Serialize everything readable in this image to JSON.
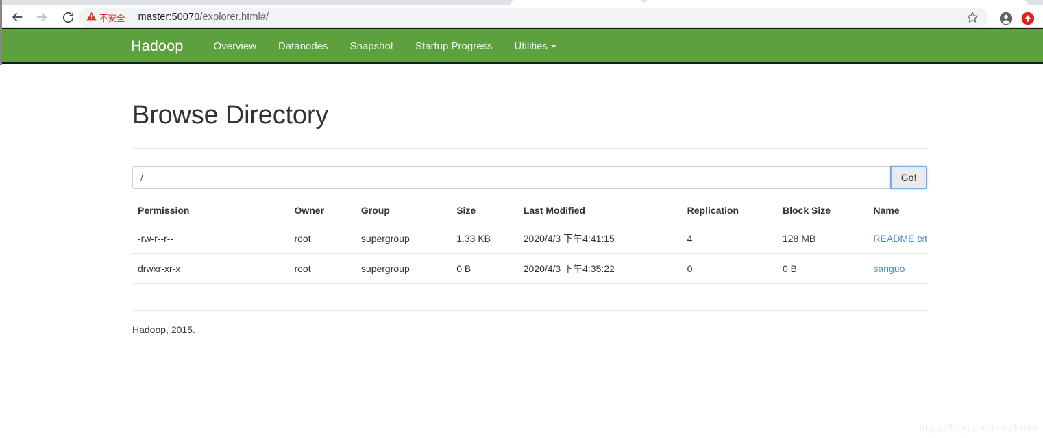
{
  "browser": {
    "back_icon": "arrow-left-icon",
    "forward_icon": "arrow-right-icon",
    "reload_icon": "reload-icon",
    "security_warning": "不安全",
    "security_icon": "warning-triangle-icon",
    "url_host": "master:50070",
    "url_path": "/explorer.html#/",
    "url_full": "master:50070/explorer.html#/",
    "star_icon": "star-icon",
    "avatar_icon": "account-circle-icon",
    "extension_icon": "extension-icon",
    "accent_red": "#d93025",
    "omnibox_bg": "#f1f3f4"
  },
  "navbar": {
    "brand": "Hadoop",
    "bg_color": "#5da13f",
    "links": [
      {
        "label": "Overview",
        "has_caret": false
      },
      {
        "label": "Datanodes",
        "has_caret": false
      },
      {
        "label": "Snapshot",
        "has_caret": false
      },
      {
        "label": "Startup Progress",
        "has_caret": false
      },
      {
        "label": "Utilities",
        "has_caret": true
      }
    ]
  },
  "main": {
    "title": "Browse Directory",
    "path_input_value": "/",
    "path_input_placeholder": "/",
    "go_button": "Go!",
    "table": {
      "headers": [
        "Permission",
        "Owner",
        "Group",
        "Size",
        "Last Modified",
        "Replication",
        "Block Size",
        "Name"
      ],
      "rows": [
        {
          "permission": "-rw-r--r--",
          "owner": "root",
          "group": "supergroup",
          "size": "1.33 KB",
          "last_modified": "2020/4/3 下午4:41:15",
          "replication": "4",
          "block_size": "128 MB",
          "name": "README.txt"
        },
        {
          "permission": "drwxr-xr-x",
          "owner": "root",
          "group": "supergroup",
          "size": "0 B",
          "last_modified": "2020/4/3 下午4:35:22",
          "replication": "0",
          "block_size": "0 B",
          "name": "sanguo"
        }
      ]
    },
    "footer": "Hadoop, 2015.",
    "link_color": "#4f8ac0"
  },
  "watermark": "https://blog.csdn.net/klionl"
}
